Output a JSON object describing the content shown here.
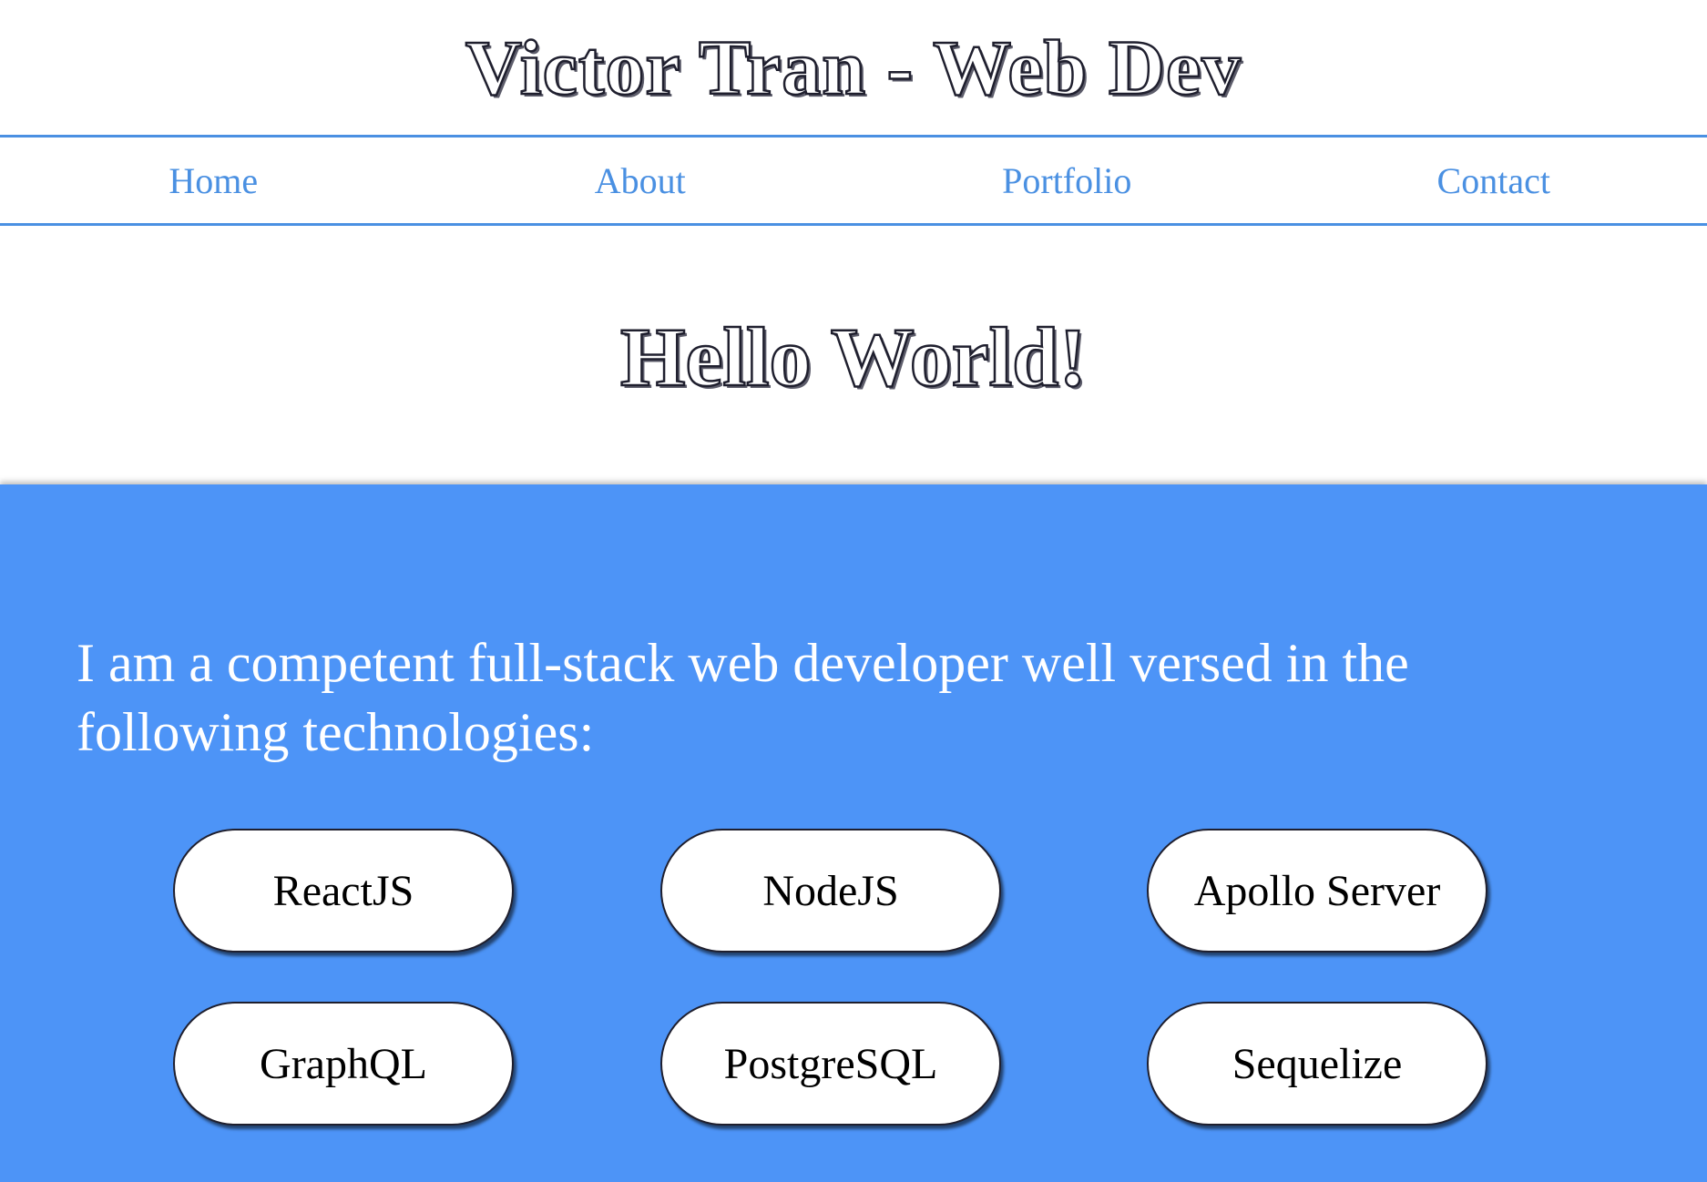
{
  "header": {
    "title": "Victor Tran - Web Dev"
  },
  "nav": {
    "items": [
      {
        "label": "Home"
      },
      {
        "label": "About"
      },
      {
        "label": "Portfolio"
      },
      {
        "label": "Contact"
      }
    ]
  },
  "hero": {
    "title": "Hello World!"
  },
  "skills": {
    "intro": "I am a competent full-stack web developer well versed in the following technologies:",
    "items": [
      {
        "label": "ReactJS"
      },
      {
        "label": "NodeJS"
      },
      {
        "label": "Apollo Server"
      },
      {
        "label": "GraphQL"
      },
      {
        "label": "PostgreSQL"
      },
      {
        "label": "Sequelize"
      }
    ]
  },
  "colors": {
    "accent": "#4a90e2",
    "section_background": "#4d94f7",
    "title_outline": "#1f1f2e"
  }
}
